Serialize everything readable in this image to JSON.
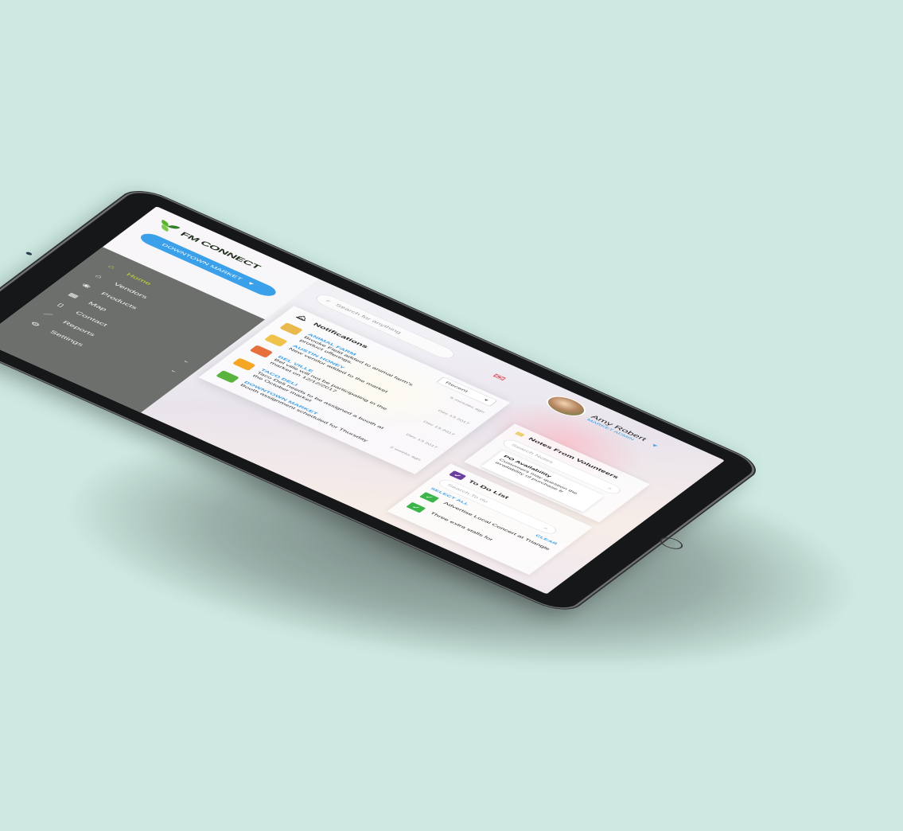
{
  "brand": {
    "name": "FM CONNECT"
  },
  "market_selector": {
    "label": "DOWNTOWN MARKET",
    "caret": "▼"
  },
  "search": {
    "placeholder": "Search for anything"
  },
  "profile": {
    "name": "Amy Robert",
    "role": "MARKET ADMIN",
    "caret": "▼"
  },
  "menu": [
    {
      "label": "Home",
      "icon": "home-icon",
      "active": true
    },
    {
      "label": "Vendors",
      "icon": "vendors-icon"
    },
    {
      "label": "Products",
      "icon": "products-icon"
    },
    {
      "label": "Map",
      "icon": "map-icon"
    },
    {
      "label": "Contact",
      "icon": "contact-icon",
      "chevron": "⌄"
    },
    {
      "label": "Reports",
      "icon": "reports-icon",
      "chevron": "⌄"
    },
    {
      "label": "Settings",
      "icon": "settings-icon"
    }
  ],
  "notifications": {
    "title": "Notifications",
    "filter": "Recent",
    "items": [
      {
        "vendor": "ANIMAL FARM",
        "message": "Brooke Field added to animal farm's product offerings.",
        "date": "5 minutes ago"
      },
      {
        "vendor": "AUSTIN HONEY",
        "message": "New vendor added to the market",
        "date": "Dec 13 2017"
      },
      {
        "vendor": "BEL VILLE",
        "message": "Bel ville will not be participating in the market on 12/12/2017",
        "date": "Dec 13 2017"
      },
      {
        "vendor": "TACO DELI",
        "message": "Taco Deli needs to be assigned a booth at the October market",
        "date": "Dec 13 2017"
      },
      {
        "vendor": "DOWNTOWN MARKET",
        "message": "Booth assignment scheduled for Thursday",
        "date": "2 weeks ago"
      }
    ]
  },
  "volunteer_notes": {
    "title": "Notes From Volunteers",
    "search_placeholder": "Search Notes",
    "note": {
      "title": "PO Availability",
      "body": "Customers may question the availability of purchase fr"
    }
  },
  "todo": {
    "title": "To Do List",
    "search_placeholder": "Search To do",
    "select_all": "SELECT ALL",
    "clear": "CLEAR",
    "items": [
      {
        "text": "Advertise Local Concert at Triangle",
        "checked": true
      },
      {
        "text": "Three extra stalls for",
        "checked": true
      }
    ]
  },
  "colors": {
    "accent": "#3aa0e9",
    "menu_bg": "#6c6f6c",
    "active": "#c9d93c",
    "background": "#cde9e1"
  }
}
